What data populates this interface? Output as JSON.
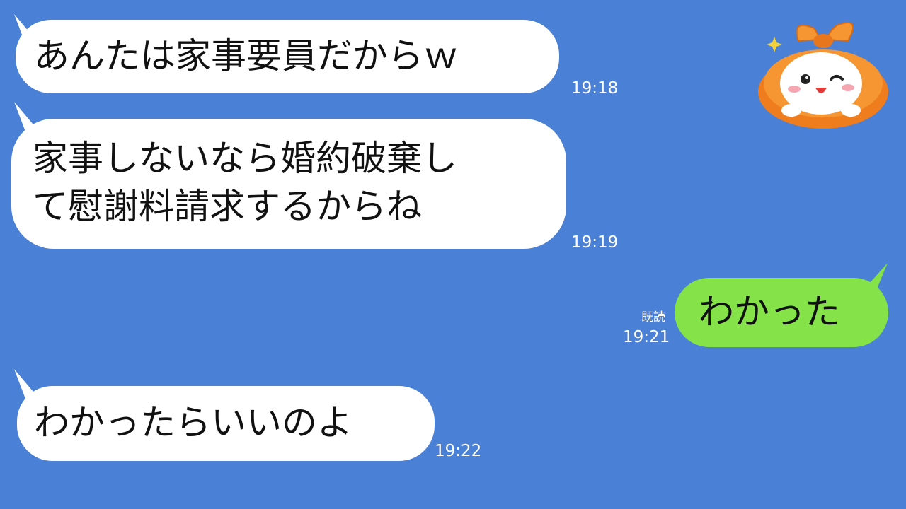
{
  "messages": [
    {
      "side": "left",
      "text": "あんたは家事要員だからｗ",
      "time": "19:18"
    },
    {
      "side": "left",
      "line1": "家事しないなら婚約破棄し",
      "line2": "て慰謝料請求するからね",
      "time": "19:19"
    },
    {
      "side": "right",
      "text": "わかった",
      "read": "既読",
      "time": "19:21"
    },
    {
      "side": "left",
      "text": "わかったらいいのよ",
      "time": "19:22"
    }
  ],
  "sticker": {
    "icon": "smiling-bun-mascot-sticker"
  },
  "colors": {
    "background": "#4a80d6",
    "incoming": "#ffffff",
    "outgoing": "#85e249"
  }
}
